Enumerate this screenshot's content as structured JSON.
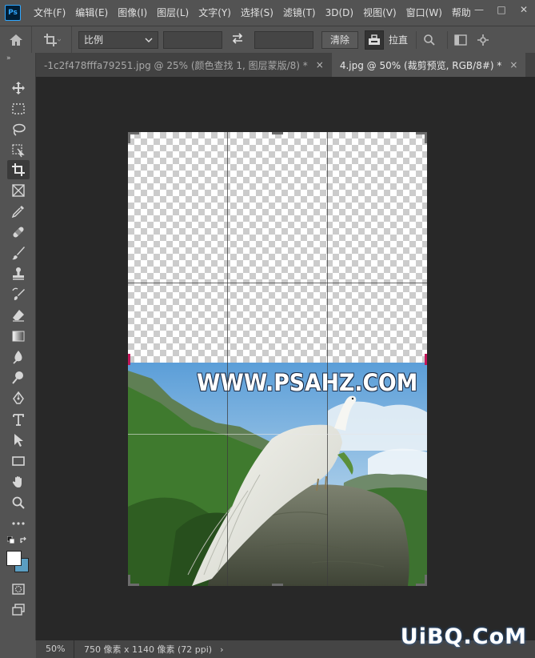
{
  "app": {
    "logo_text": "Ps"
  },
  "menu": [
    "文件(F)",
    "编辑(E)",
    "图像(I)",
    "图层(L)",
    "文字(Y)",
    "选择(S)",
    "滤镜(T)",
    "3D(D)",
    "视图(V)",
    "窗口(W)",
    "帮助"
  ],
  "window_controls": {
    "minimize": "—",
    "maximize": "□",
    "close": "✕"
  },
  "options": {
    "ratio_select": "比例",
    "width_value": "",
    "height_value": "",
    "clear_button": "清除",
    "straighten_label": "拉直"
  },
  "tabs": [
    {
      "label": "-1c2f478fffa79251.jpg @ 25% (颜色查找 1, 图层蒙版/8) *",
      "close": "×",
      "active": false
    },
    {
      "label": "4.jpg @ 50% (裁剪预览, RGB/8#) *",
      "close": "×",
      "active": true
    }
  ],
  "canvas": {
    "watermark_text": "WWW.PSAHZ.COM"
  },
  "status": {
    "zoom": "50%",
    "info": "750 像素 x 1140 像素 (72 ppi)",
    "arrow": "›"
  },
  "site_logo": "UiBQ.CoM",
  "colors": {
    "foreground": "#ffffff",
    "background": "#5b9ec2",
    "ps_accent": "#31a8ff"
  }
}
